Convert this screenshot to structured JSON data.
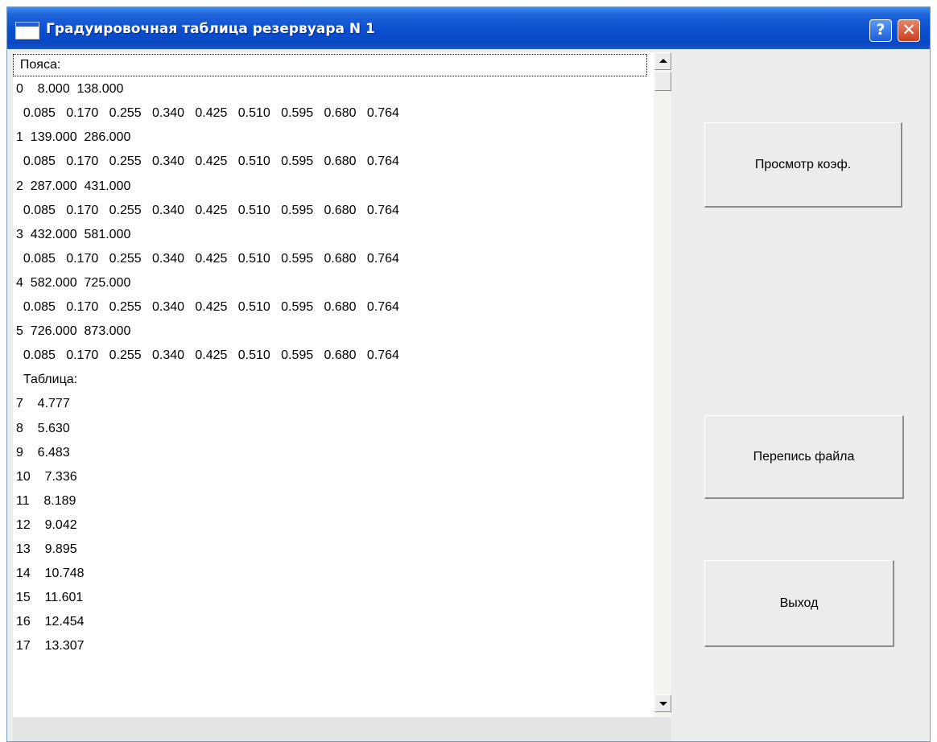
{
  "window": {
    "title": "Градуировочная таблица резервуара N 1",
    "help_label": "?",
    "close_label": "✕"
  },
  "listbox": {
    "items": [
      "  Пояса:",
      "0    8.000  138.000",
      "  0.085   0.170   0.255   0.340   0.425   0.510   0.595   0.680   0.764",
      "1  139.000  286.000",
      "  0.085   0.170   0.255   0.340   0.425   0.510   0.595   0.680   0.764",
      "2  287.000  431.000",
      "  0.085   0.170   0.255   0.340   0.425   0.510   0.595   0.680   0.764",
      "3  432.000  581.000",
      "  0.085   0.170   0.255   0.340   0.425   0.510   0.595   0.680   0.764",
      "4  582.000  725.000",
      "  0.085   0.170   0.255   0.340   0.425   0.510   0.595   0.680   0.764",
      "5  726.000  873.000",
      "  0.085   0.170   0.255   0.340   0.425   0.510   0.595   0.680   0.764",
      "  Таблица:",
      "7    4.777",
      "8    5.630",
      "9    6.483",
      "10    7.336",
      "11    8.189",
      "12    9.042",
      "13    9.895",
      "14    10.748",
      "15    11.601",
      "16    12.454",
      "17    13.307"
    ]
  },
  "buttons": {
    "view_coef": "Просмотр коэф.",
    "rewrite_file": "Перепись файла",
    "exit": "Выход"
  },
  "icons": {
    "app": "window-app-icon",
    "help": "help-icon",
    "close": "close-icon",
    "scroll_up": "scroll-up-arrow-icon",
    "scroll_down": "scroll-down-arrow-icon"
  },
  "colors": {
    "titlebar": "#0a4fd0",
    "close_button": "#c8401e",
    "window_bg": "#ededed",
    "list_bg": "#ffffff"
  }
}
